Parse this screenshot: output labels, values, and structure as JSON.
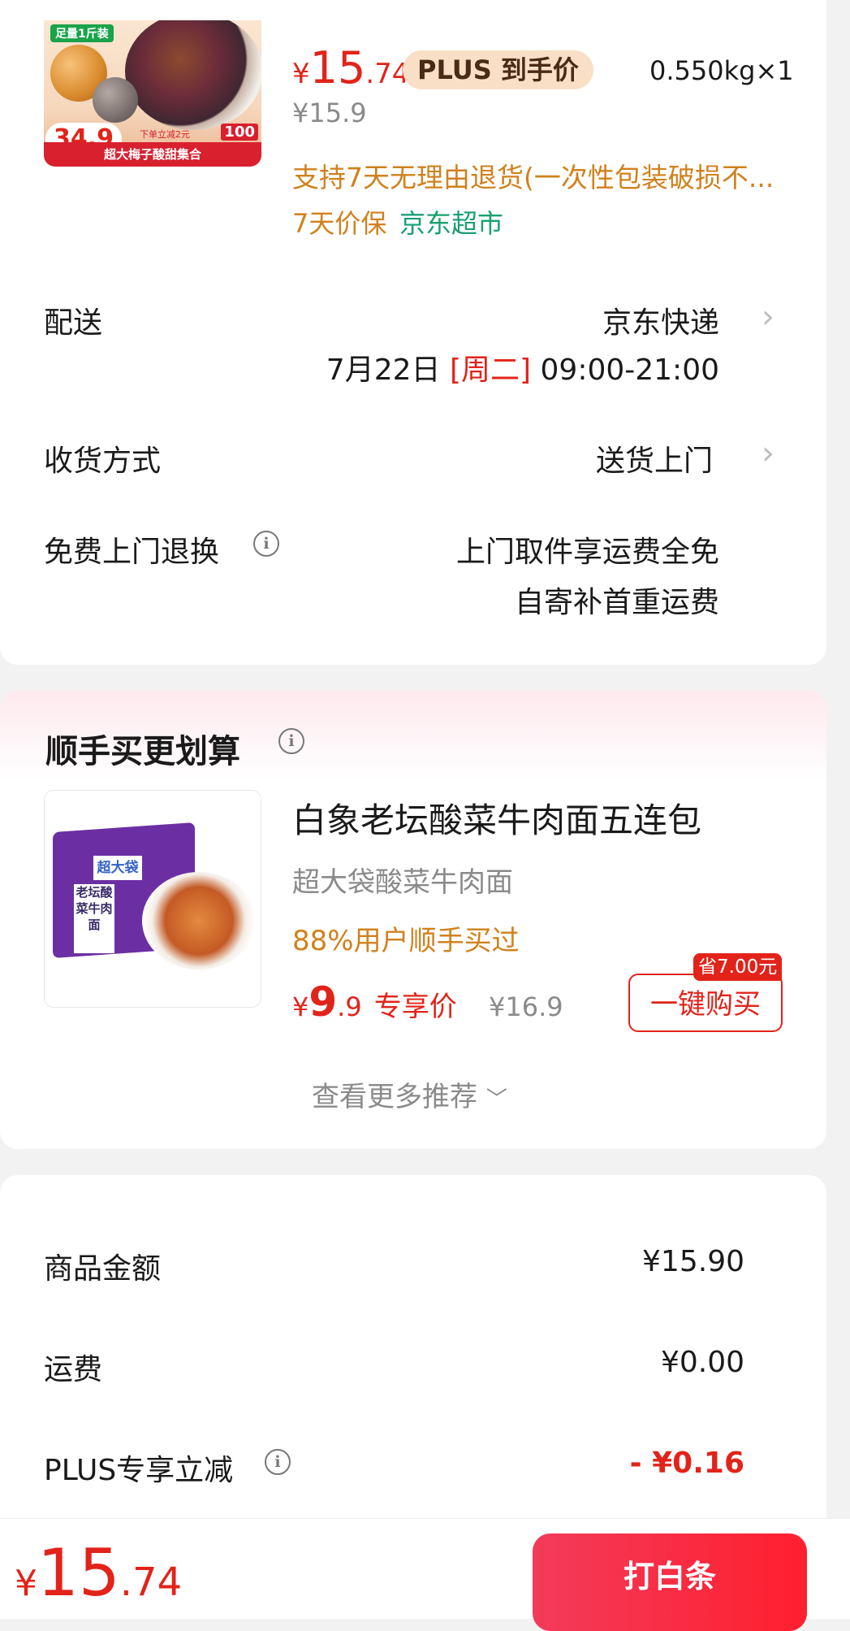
{
  "product": {
    "image_alt": "超大梅子酸甜集合",
    "image_tag": "足量1斤装",
    "image_price_badge": "34.9",
    "image_strip": "超大梅子酸甜集合",
    "image_sub": "下单立减2元",
    "image_hundred": "100",
    "price_symbol": "¥",
    "price_int": "15",
    "price_dec": ".74",
    "plus_label": "PLUS 到手价",
    "original_price": "¥15.9",
    "weight_qty": "0.550kg×1",
    "return_policy": "支持7天无理由退货(一次性包装破损不...",
    "price_protect": "7天价保",
    "store": "京东超市"
  },
  "delivery": {
    "label": "配送",
    "carrier": "京东快递",
    "date": "7月22日",
    "weekday": "[周二]",
    "time": "09:00-21:00"
  },
  "receive": {
    "label": "收货方式",
    "value": "送货上门"
  },
  "free_return": {
    "label": "免费上门退换",
    "line1": "上门取件享运费全免",
    "line2": "自寄补首重运费"
  },
  "addon": {
    "title": "顺手买更划算",
    "item_name": "白象老坛酸菜牛肉面五连包",
    "item_sub": "超大袋酸菜牛肉面",
    "item_stat": "88%用户顺手买过",
    "price_symbol": "¥",
    "price_int": "9",
    "price_dec": ".9",
    "price_label": "专享价",
    "original_price": "¥16.9",
    "save_tag": "省7.00元",
    "buy_button": "一键购买",
    "more_link": "查看更多推荐",
    "img_pack_text": "超大袋",
    "img_label_text": "老坛酸菜牛肉面"
  },
  "summary": {
    "goods_label": "商品金额",
    "goods_value": "¥15.90",
    "shipping_label": "运费",
    "shipping_value": "¥0.00",
    "plus_label": "PLUS专享立减",
    "plus_value": "- ¥0.16"
  },
  "bottom": {
    "price_symbol": "¥",
    "price_int": "15",
    "price_dec": ".74",
    "pay_button": "打白条"
  },
  "colors": {
    "accent_red": "#e2231a",
    "orange": "#d0811d",
    "green": "#19a06f"
  }
}
